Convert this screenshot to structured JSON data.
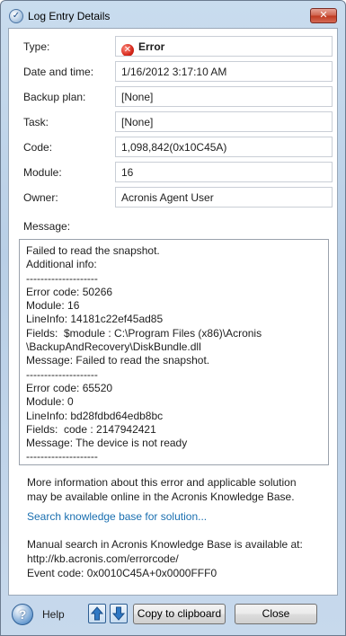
{
  "window": {
    "title": "Log Entry Details",
    "close_glyph": "✕"
  },
  "fields": {
    "type": {
      "label": "Type:",
      "value": "Error",
      "icon": "error-icon"
    },
    "date_time": {
      "label": "Date and time:",
      "value": "1/16/2012 3:17:10 AM"
    },
    "backup_plan": {
      "label": "Backup plan:",
      "value": "[None]"
    },
    "task": {
      "label": "Task:",
      "value": "[None]"
    },
    "code": {
      "label": "Code:",
      "value": "1,098,842(0x10C45A)"
    },
    "module": {
      "label": "Module:",
      "value": "16"
    },
    "owner": {
      "label": "Owner:",
      "value": "Acronis Agent User"
    }
  },
  "message": {
    "label": "Message:",
    "lines": [
      "Failed to read the snapshot.",
      "Additional info:",
      "--------------------",
      "Error code: 50266",
      "Module: 16",
      "LineInfo: 14181c22ef45ad85",
      "Fields:  $module : C:\\Program Files (x86)\\Acronis",
      "\\BackupAndRecovery\\DiskBundle.dll",
      "Message: Failed to read the snapshot.",
      "--------------------",
      "Error code: 65520",
      "Module: 0",
      "LineInfo: bd28fdbd64edb8bc",
      "Fields:  code : 2147942421",
      "Message: The device is not ready",
      "--------------------"
    ]
  },
  "info": {
    "line1": "More information about this error and applicable solution",
    "line2": "may be available online in the Acronis Knowledge Base.",
    "kb_link": "Search knowledge base for solution...",
    "manual_line1": "Manual search in Acronis Knowledge Base is available at:",
    "manual_line2": "http://kb.acronis.com/errorcode/",
    "manual_line3": "Event code: 0x0010C45A+0x0000FFF0"
  },
  "buttons": {
    "help_glyph": "?",
    "help_label": "Help",
    "up_icon": "arrow-up-icon",
    "down_icon": "arrow-down-icon",
    "copy": "Copy to clipboard",
    "close": "Close"
  },
  "colors": {
    "link": "#1a6fb0",
    "error": "#d4271a"
  }
}
